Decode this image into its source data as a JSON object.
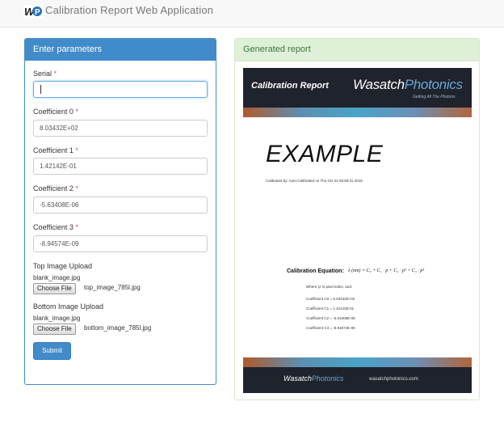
{
  "app": {
    "title": "Calibration Report Web Application"
  },
  "form": {
    "heading": "Enter parameters",
    "required_mark": "*",
    "fields": [
      {
        "label": "Serial",
        "value": ""
      },
      {
        "label": "Coefficient 0",
        "value": "8.03432E+02"
      },
      {
        "label": "Coefficient 1",
        "value": "1.42142E-01"
      },
      {
        "label": "Coefficient 2",
        "value": "-5.63408E-06"
      },
      {
        "label": "Coefficient 3",
        "value": "-8.94574E-09"
      }
    ],
    "top_upload": {
      "label": "Top Image Upload",
      "current": "blank_image.jpg",
      "button": "Choose File",
      "file": "top_image_785l.jpg"
    },
    "bottom_upload": {
      "label": "Bottom Image Upload",
      "current": "blank_image.jpg",
      "button": "Choose File",
      "file": "bottom_image_785l.jpg"
    },
    "submit": "Submit"
  },
  "report_panel": {
    "heading": "Generated report",
    "header_title": "Calibration Report",
    "brand_a": "Wasatch",
    "brand_b": "Photonics",
    "brand_tagline": "Getting All The Photons",
    "example": "EXAMPLE",
    "calibrated_by": "Calibrated by: Auto-Calibrated on Thu Oct 22 06:59:31 2015",
    "equation_label": "Calibration Equation:",
    "equation": "λ (nm) = C₀ + C₁ · p + C₂ · p² + C₃ · p³",
    "where": "Where 'p' is pixel index, and:",
    "coefficients": [
      "Coefficient C0 = 8.03432E+02",
      "Coefficient C1 = 1.42142E-01",
      "Coefficient C2 = -5.63408E-06",
      "Coefficient C3 = -8.94574E-09"
    ],
    "footer_url": "wasatchphotonics.com"
  },
  "colors": {
    "primary": "#428bca",
    "success_bg": "#dff0d8",
    "success_text": "#3c763d",
    "required": "#d9534f"
  }
}
